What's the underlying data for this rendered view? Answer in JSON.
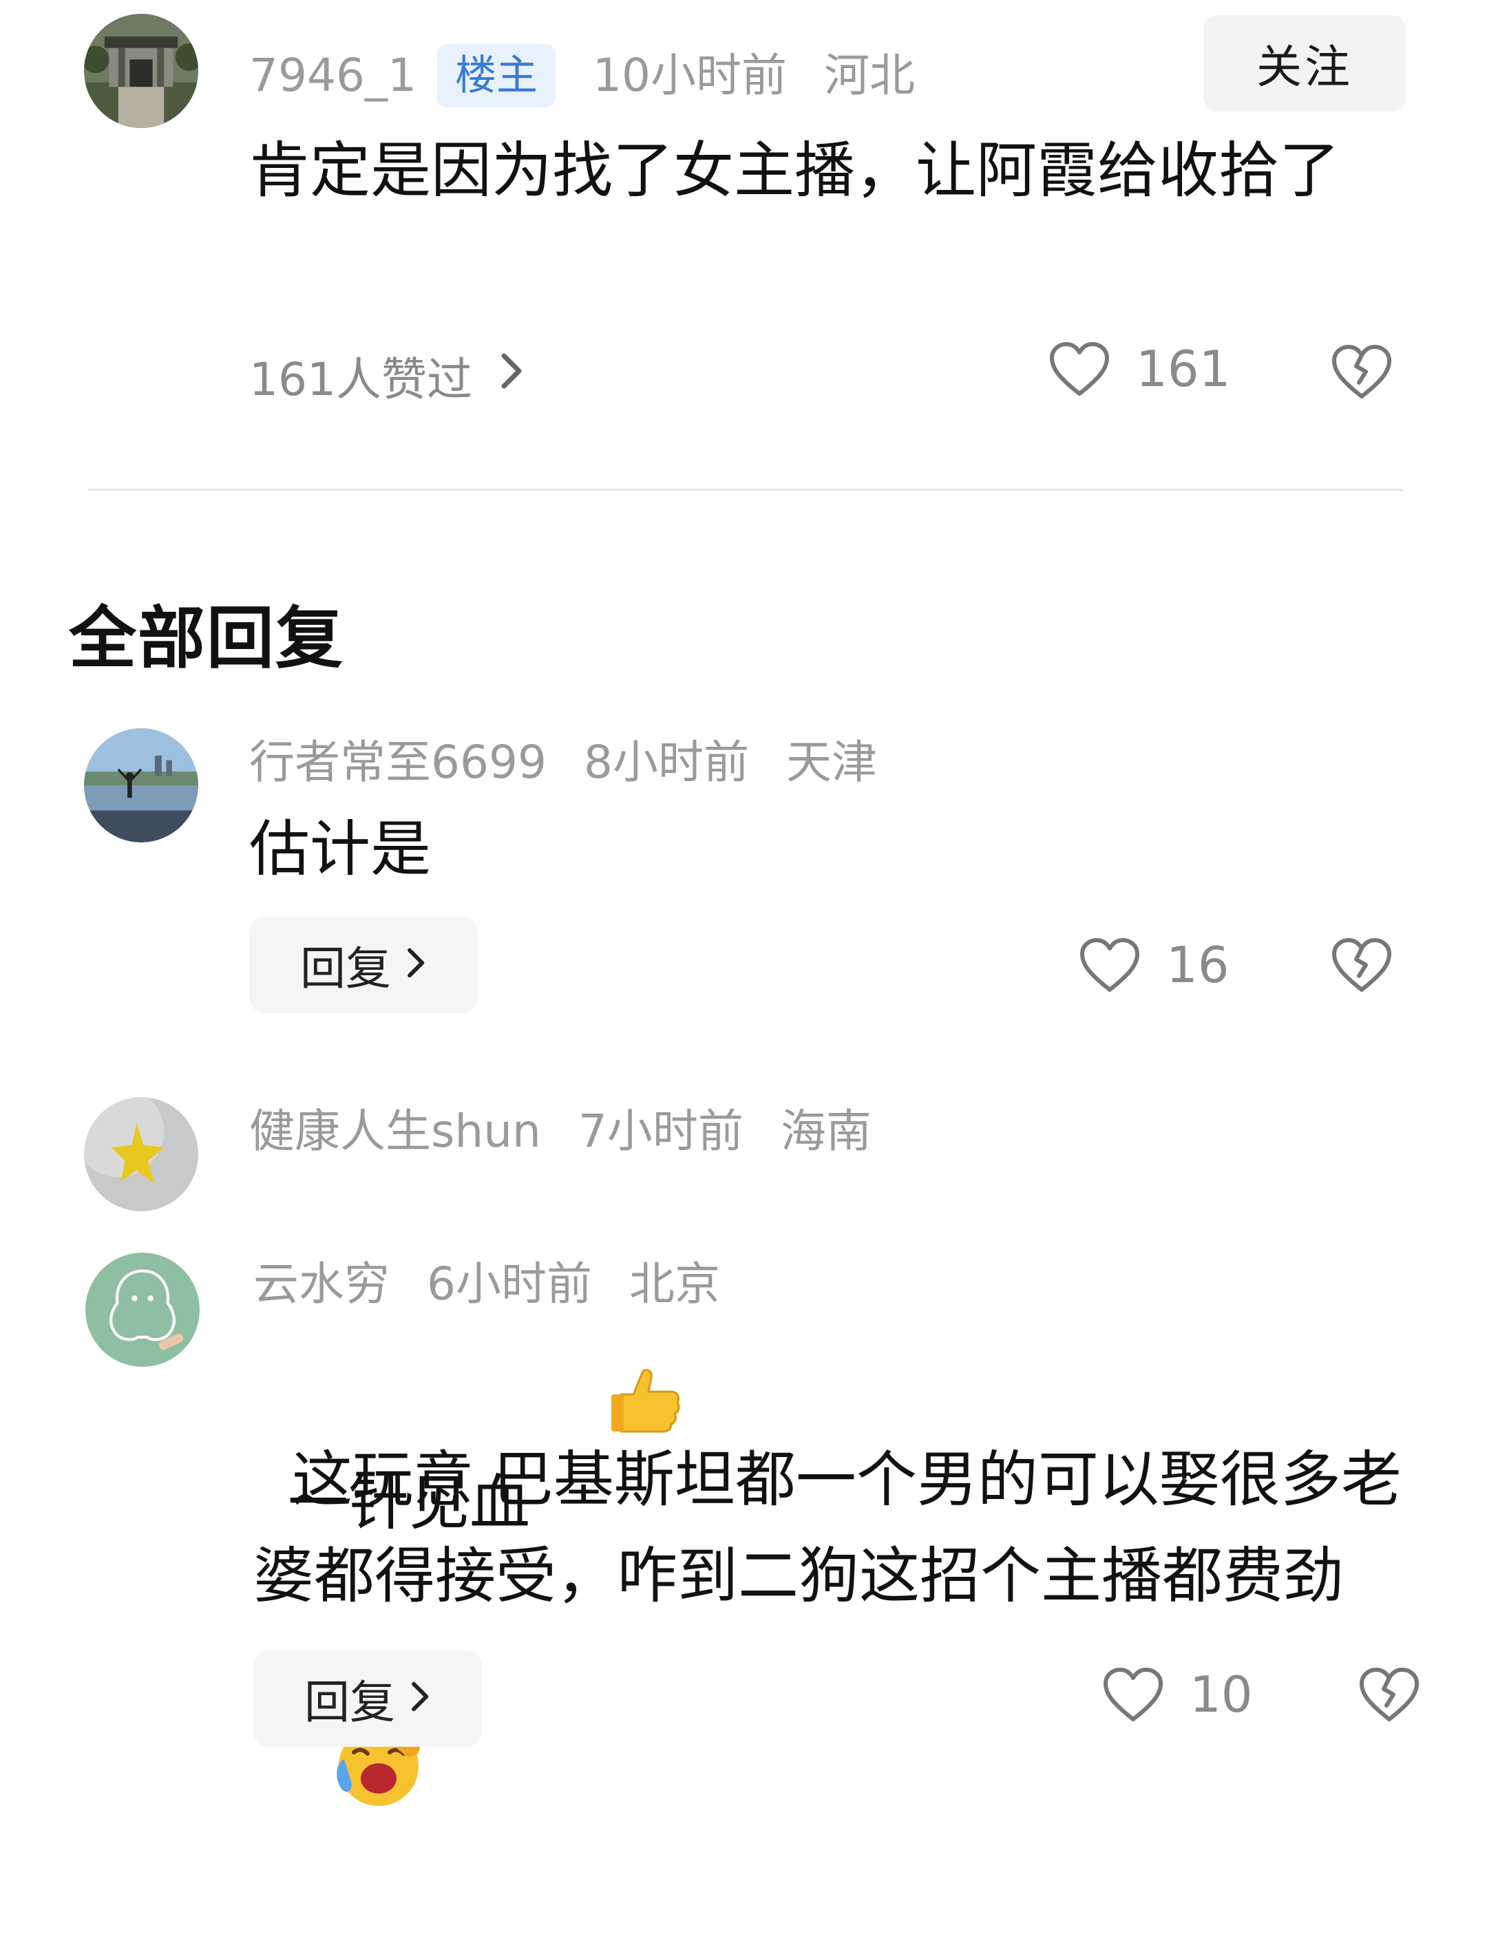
{
  "main_comment": {
    "username": "7946_1",
    "op_badge": "楼主",
    "time": "10小时前",
    "location": "河北",
    "follow_label": "关注",
    "content": "肯定是因为找了女主播，让阿霞给收拾了",
    "likes_summary": "161人赞过",
    "like_count": "161"
  },
  "section_title": "全部回复",
  "replies": [
    {
      "username": "行者常至6699",
      "time": "8小时前",
      "location": "天津",
      "content": "估计是",
      "reply_label": "回复",
      "like_count": "16"
    },
    {
      "username": "健康人生shun",
      "time": "7小时前",
      "location": "海南",
      "content": "一针见血",
      "emoji": "thumbs-up"
    },
    {
      "username": "云水穷",
      "time": "6小时前",
      "location": "北京",
      "content": "这玩意 巴基斯坦都一个男的可以娶很多老婆都得接受，咋到二狗这招个主播都费劲",
      "emoji": "laughing-crying",
      "reply_label": "回复",
      "like_count": "10"
    }
  ],
  "colors": {
    "meta_text": "#9a9a9a",
    "badge_bg": "#e9f1fc",
    "badge_text": "#3a7bd5",
    "button_bg": "#f3f3f3"
  }
}
